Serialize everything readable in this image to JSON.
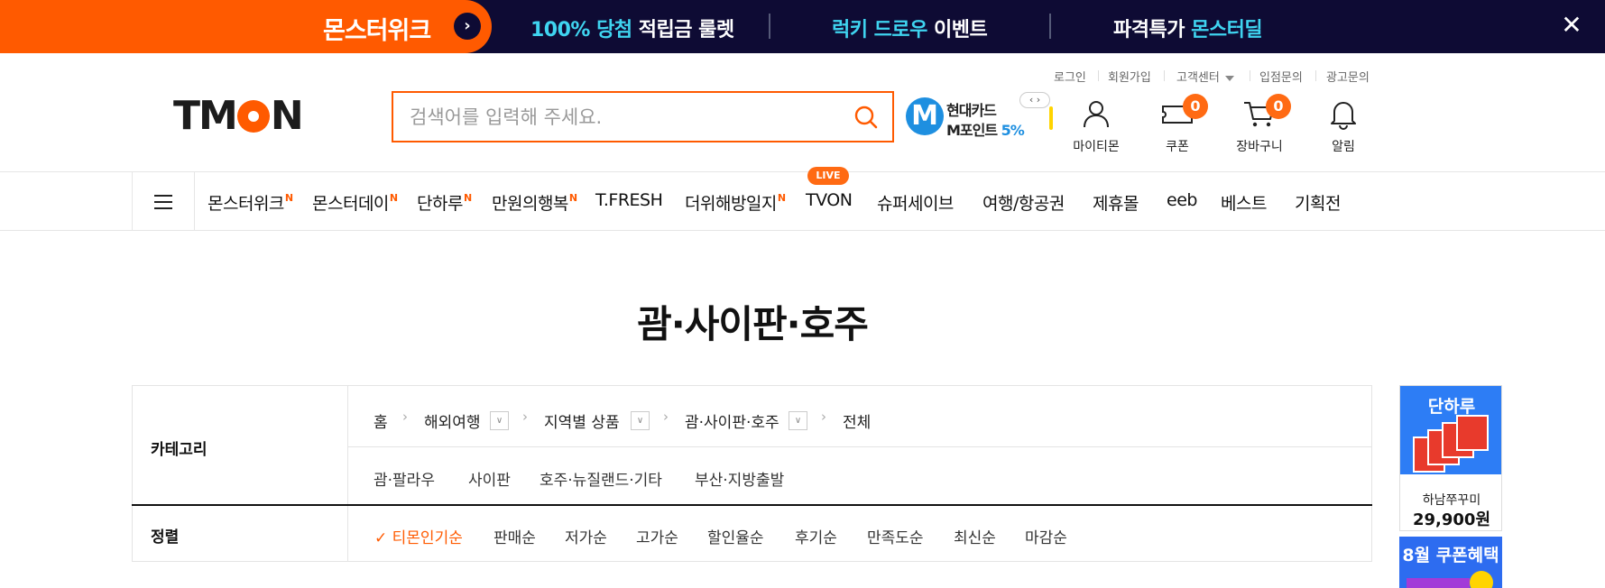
{
  "promo": {
    "left_label": "몬스터위크",
    "item1_hl": "100% 당첨",
    "item1_rest": " 적립금 룰렛",
    "item2_hl": "럭키 드로우",
    "item2_rest": " 이벤트",
    "item3_pre": "파격특가 ",
    "item3_hl": "몬스터딜",
    "close": "✕"
  },
  "util_links": [
    "로그인",
    "회원가입",
    "고객센터",
    "입점문의",
    "광고문의"
  ],
  "logo": {
    "pre": "TM",
    "post": "N"
  },
  "search": {
    "placeholder": "검색어를 입력해 주세요."
  },
  "card_promo": {
    "line1": "현대카드",
    "line2": "M포인트 ",
    "pct": "5%",
    "nav": "‹ ›"
  },
  "header_icons": {
    "mytmon": "마이티몬",
    "coupon": "쿠폰",
    "coupon_count": "0",
    "cart": "장바구니",
    "cart_count": "0",
    "alarm": "알림"
  },
  "nav": {
    "items": [
      {
        "label": "몬스터위크",
        "new": "N"
      },
      {
        "label": "몬스터데이",
        "new": "N"
      },
      {
        "label": "단하루",
        "new": "N"
      },
      {
        "label": "만원의행복",
        "new": "N"
      },
      {
        "label": "T.FRESH",
        "new": ""
      },
      {
        "label": "더위해방일지",
        "new": "N"
      },
      {
        "label": "TVON",
        "new": ""
      },
      {
        "label": "슈퍼세이브",
        "new": ""
      },
      {
        "label": "여행/항공권",
        "new": ""
      },
      {
        "label": "제휴몰",
        "new": ""
      },
      {
        "label": "eeb",
        "new": ""
      },
      {
        "label": "베스트",
        "new": ""
      },
      {
        "label": "기획전",
        "new": ""
      }
    ],
    "live": "LIVE"
  },
  "page_title": "괌·사이판·호주",
  "category": {
    "label": "카테고리",
    "crumbs": [
      "홈",
      "해외여행",
      "지역별 상품",
      "괌·사이판·호주",
      "전체"
    ],
    "sub_items": [
      "괌·팔라우",
      "사이판",
      "호주·뉴질랜드·기타",
      "부산·지방출발"
    ]
  },
  "sort": {
    "label": "정렬",
    "items": [
      "✓ 티몬인기순",
      "판매순",
      "저가순",
      "고가순",
      "할인율순",
      "후기순",
      "만족도순",
      "최신순",
      "마감순"
    ]
  },
  "right_banner": {
    "title": "단하루",
    "name": "하남쭈꾸미",
    "price": "29,900원"
  },
  "right_banner2": {
    "title": "8월 쿠폰혜택"
  },
  "colors": {
    "accent": "#ff5a00",
    "promo_bg": "#0e0b34",
    "highlight": "#3fd4f0",
    "badge": "#ff6a13"
  }
}
